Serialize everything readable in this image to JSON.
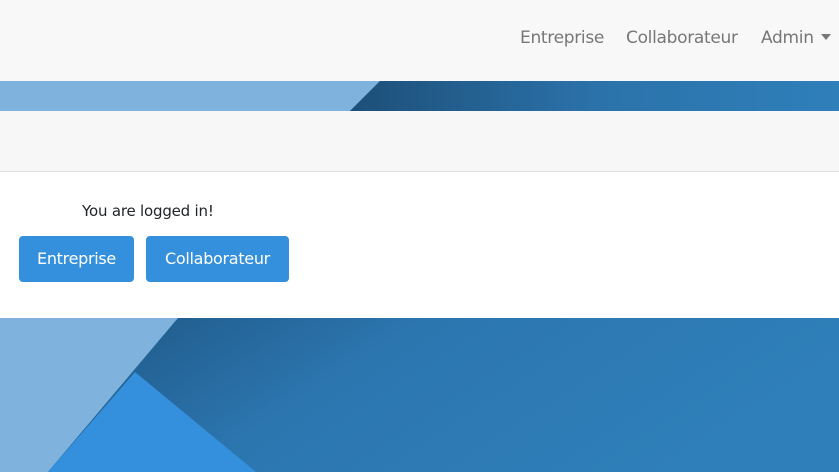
{
  "nav": {
    "items": [
      {
        "label": "Entreprise"
      },
      {
        "label": "Collaborateur"
      },
      {
        "label": "Admin"
      }
    ]
  },
  "main": {
    "status_text": "You are logged in!",
    "buttons": [
      {
        "label": "Entreprise"
      },
      {
        "label": "Collaborateur"
      }
    ]
  },
  "colors": {
    "navbar_bg": "#f8f8f8",
    "nav_text": "#777777",
    "primary_button": "#3490dc",
    "background_blue": "#2f7fba",
    "background_light_blue": "#7fb3dd"
  },
  "icons": {
    "admin_dropdown": "caret-down-icon"
  }
}
